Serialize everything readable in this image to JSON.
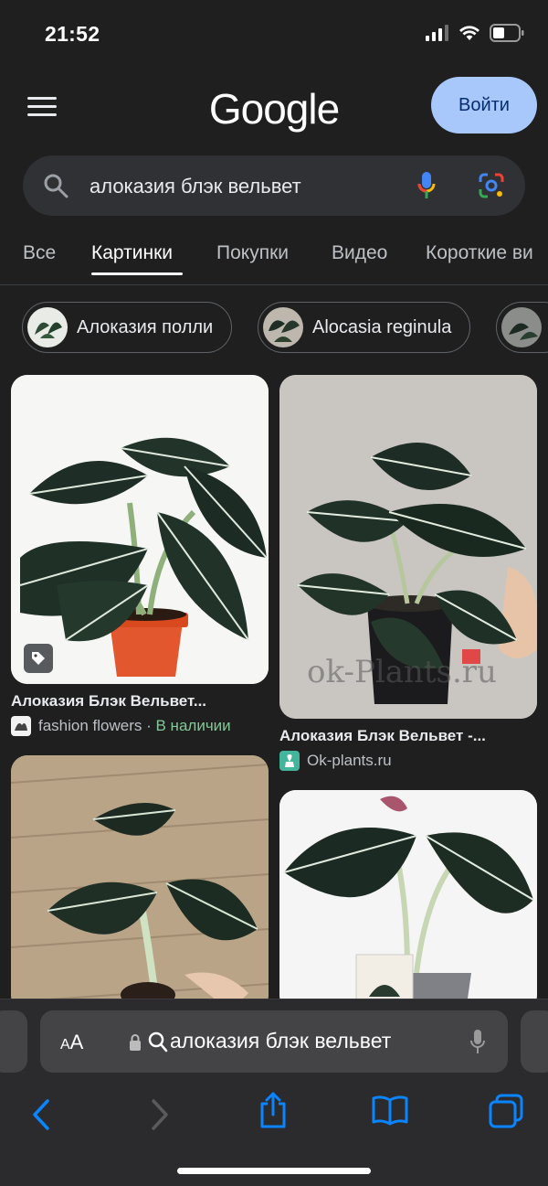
{
  "status_bar": {
    "time": "21:52"
  },
  "header": {
    "logo": "Google",
    "signin_label": "Войти"
  },
  "search": {
    "query": "алоказия блэк вельвет"
  },
  "tabs": [
    {
      "label": "Все",
      "active": false
    },
    {
      "label": "Картинки",
      "active": true
    },
    {
      "label": "Покупки",
      "active": false
    },
    {
      "label": "Видео",
      "active": false
    },
    {
      "label": "Короткие ви",
      "active": false
    }
  ],
  "chips": [
    {
      "label": "Алоказия полли"
    },
    {
      "label": "Alocasia reginula"
    }
  ],
  "results": [
    {
      "title": "Алоказия Блэк Вельвет...",
      "source": "fashion flowers",
      "separator": " · ",
      "availability": "В наличии",
      "has_tag": true
    },
    {
      "title": "Алоказия Блэк Вельвет -...",
      "source": "Ok-plants.ru",
      "watermark": "ok-Plants.ru"
    },
    {
      "title": "",
      "source": ""
    },
    {
      "title": "",
      "source": ""
    }
  ],
  "safari": {
    "text_size_label_small": "A",
    "text_size_label_large": "A",
    "address": "алоказия блэк вельвет"
  },
  "colors": {
    "background": "#1f1f1f",
    "accent": "#a8c7fa",
    "available": "#81c995",
    "safari_blue": "#0a84ff"
  }
}
